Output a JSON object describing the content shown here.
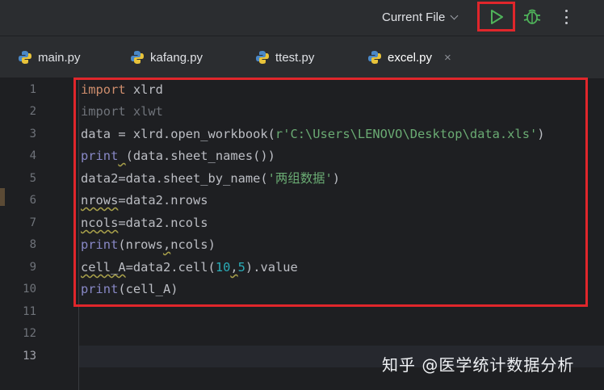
{
  "toolbar": {
    "run_config": "Current File",
    "accent_run": "#4fb35a",
    "highlight_color": "#e0262b"
  },
  "tabs": [
    {
      "label": "main.py",
      "icon": "python-icon"
    },
    {
      "label": "kafang.py",
      "icon": "python-icon"
    },
    {
      "label": "ttest.py",
      "icon": "python-icon"
    },
    {
      "label": "excel.py",
      "icon": "python-icon",
      "active": true,
      "close": "×"
    }
  ],
  "line_numbers": [
    "1",
    "2",
    "3",
    "4",
    "5",
    "6",
    "7",
    "8",
    "9",
    "10",
    "11",
    "12",
    "13"
  ],
  "code": {
    "l1_kw": "import",
    "l1_rest": " xlrd",
    "l2": "import xlwt",
    "l3_a": "data = xlrd.open_workbook(",
    "l3_str": "r'C:\\Users\\LENOVO\\Desktop\\data.xls'",
    "l3_b": ")",
    "l4_fn": "print",
    "l4_sp": " ",
    "l4_rest": "(data.sheet_names())",
    "l5_a": "data2=data.sheet_by_name(",
    "l5_str": "'两组数据'",
    "l5_b": ")",
    "l6_a": "nrows",
    "l6_b": "=data2.nrows",
    "l7_a": "ncols",
    "l7_b": "=data2.ncols",
    "l8_fn": "print",
    "l8_a": "(nrows",
    "l8_comma": ",",
    "l8_b": "ncols)",
    "l9_a": "cell_A",
    "l9_b": "=data2.cell(",
    "l9_n1": "10",
    "l9_comma": ",",
    "l9_n2": "5",
    "l9_c": ").value",
    "l10_fn": "print",
    "l10_rest": "(cell_A)"
  },
  "watermark": "知乎 @医学统计数据分析"
}
